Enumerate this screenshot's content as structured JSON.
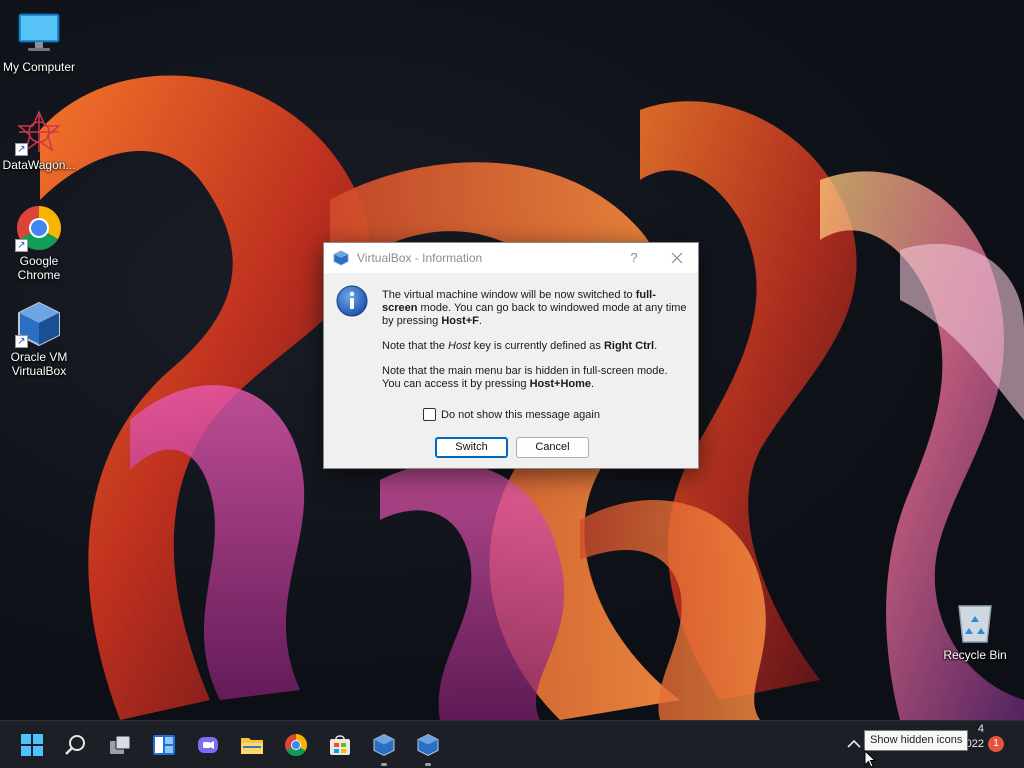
{
  "desktop": {
    "icons": [
      {
        "label": "My Computer",
        "icon": "monitor-icon"
      },
      {
        "label": "DataWagon...",
        "icon": "datawagon-icon"
      },
      {
        "label": "Google Chrome",
        "icon": "chrome-icon"
      },
      {
        "label": "Oracle VM VirtualBox",
        "icon": "virtualbox-icon"
      },
      {
        "label": "Recycle Bin",
        "icon": "recycle-bin-icon"
      }
    ]
  },
  "dialog": {
    "title": "VirtualBox - Information",
    "help_label": "?",
    "msg1_a": "The virtual machine window will be now switched to ",
    "msg1_b": "full-screen",
    "msg1_c": " mode. You can go back to windowed mode at any time by pressing ",
    "msg1_d": "Host+F",
    "msg1_e": ".",
    "msg2_a": "Note that the ",
    "msg2_b": "Host",
    "msg2_c": " key is currently defined as ",
    "msg2_d": "Right Ctrl",
    "msg2_e": ".",
    "msg3_a": "Note that the main menu bar is hidden in full-screen mode. You can access it by pressing ",
    "msg3_b": "Host+Home",
    "msg3_c": ".",
    "checkbox_label": "Do not show this message again",
    "checkbox_checked": false,
    "switch_label": "Switch",
    "cancel_label": "Cancel"
  },
  "taskbar": {
    "items": [
      "start-icon",
      "search-icon",
      "task-view-icon",
      "widgets-icon",
      "chat-icon",
      "file-explorer-icon",
      "chrome-icon",
      "store-icon",
      "virtualbox-icon",
      "virtualbox-icon"
    ],
    "tooltip": "Show hidden icons",
    "clock_time": "4",
    "clock_date": "1/8/2022",
    "notification_count": "1"
  },
  "colors": {
    "accent": "#0067c0",
    "taskbar_bg": "#1c1f26",
    "badge": "#e5543f"
  }
}
